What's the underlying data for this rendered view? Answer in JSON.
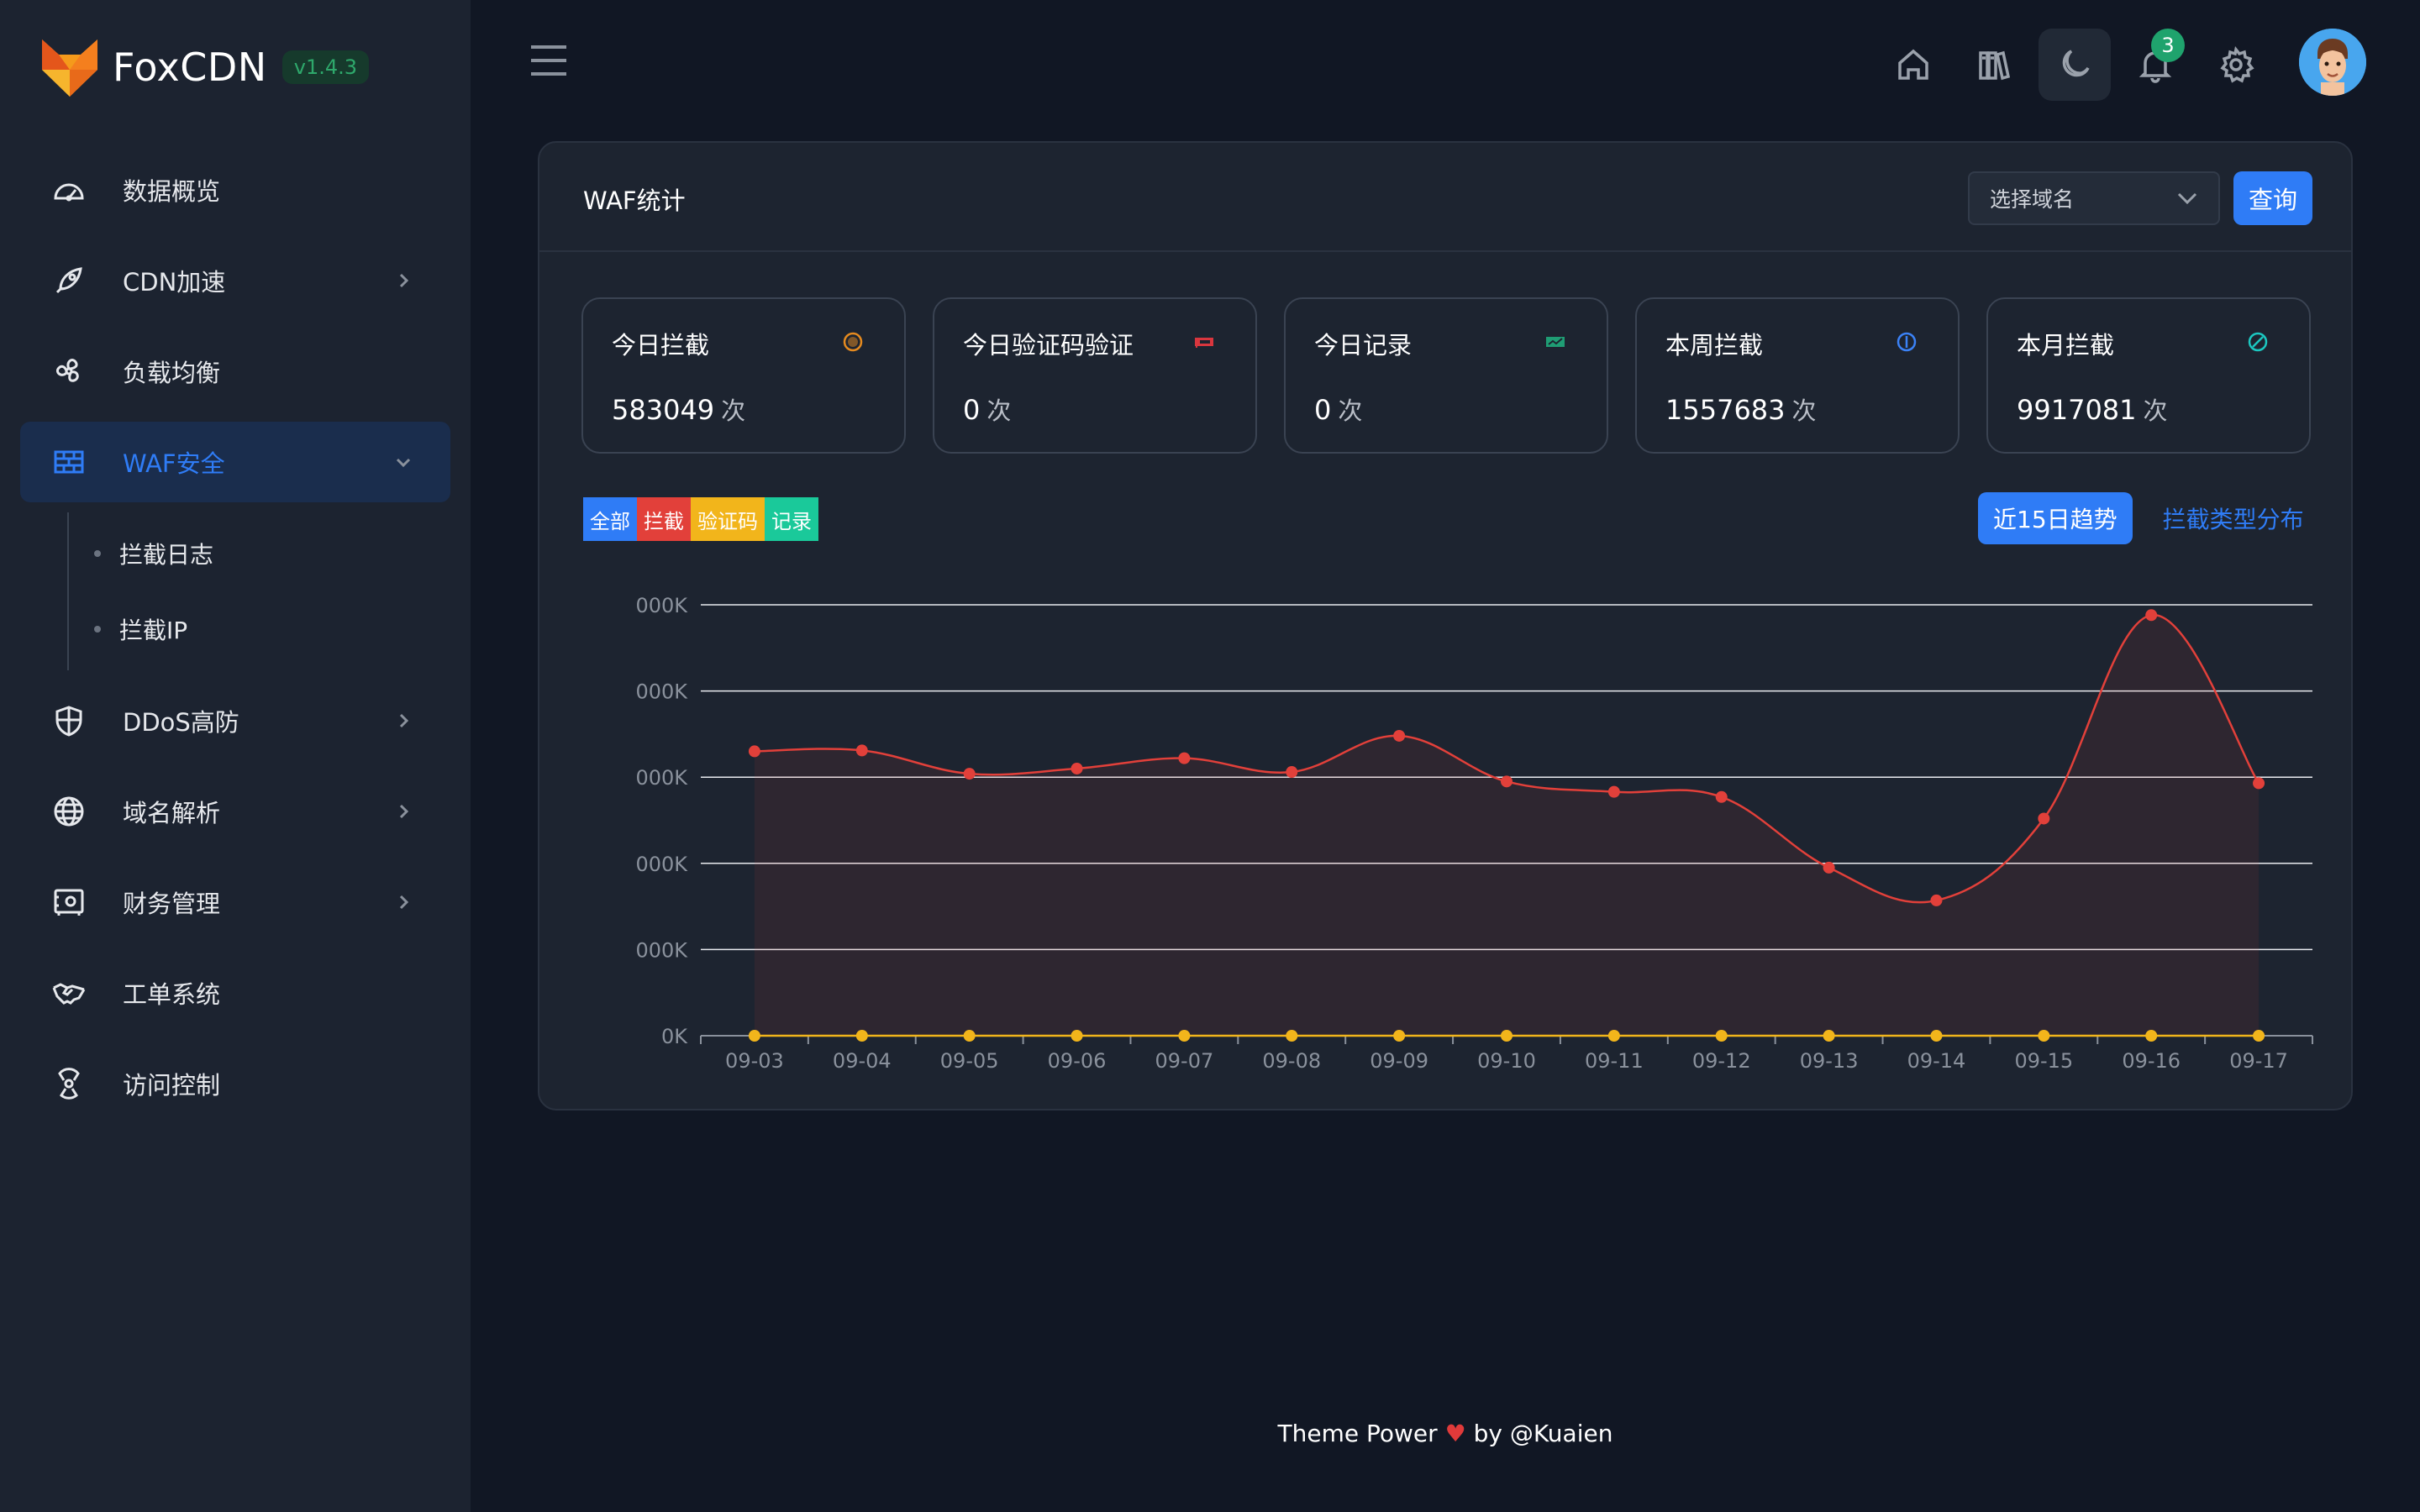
{
  "brand": {
    "name": "FoxCDN",
    "version": "v1.4.3"
  },
  "menu": [
    {
      "label": "数据概览",
      "icon": "dashboard-icon",
      "has_children": false
    },
    {
      "label": "CDN加速",
      "icon": "rocket-icon",
      "has_children": true
    },
    {
      "label": "负载均衡",
      "icon": "fan-icon",
      "has_children": false
    },
    {
      "label": "WAF安全",
      "icon": "firewall-icon",
      "has_children": true,
      "active": true,
      "expanded": true,
      "children": [
        {
          "label": "拦截日志"
        },
        {
          "label": "拦截IP"
        }
      ]
    },
    {
      "label": "DDoS高防",
      "icon": "shield-icon",
      "has_children": true
    },
    {
      "label": "域名解析",
      "icon": "globe-icon",
      "has_children": true
    },
    {
      "label": "财务管理",
      "icon": "safe-icon",
      "has_children": true
    },
    {
      "label": "工单系统",
      "icon": "handshake-icon",
      "has_children": false
    },
    {
      "label": "访问控制",
      "icon": "access-control-icon",
      "has_children": false
    }
  ],
  "topbar": {
    "notification_count": "3",
    "icons": [
      "home-icon",
      "books-icon",
      "moon-icon",
      "bell-icon",
      "gear-icon"
    ]
  },
  "card": {
    "title": "WAF统计",
    "domain_select_placeholder": "选择域名",
    "query_label": "查询",
    "stats": [
      {
        "title": "今日拦截",
        "value": "583049",
        "unit": "次",
        "icon_color": "#e58a1f"
      },
      {
        "title": "今日验证码验证",
        "value": "0",
        "unit": "次",
        "icon_color": "#d9363e"
      },
      {
        "title": "今日记录",
        "value": "0",
        "unit": "次",
        "icon_color": "#1f9d74"
      },
      {
        "title": "本周拦截",
        "value": "1557683",
        "unit": "次",
        "icon_color": "#3b82f6"
      },
      {
        "title": "本月拦截",
        "value": "9917081",
        "unit": "次",
        "icon_color": "#1cc7c0"
      }
    ],
    "legend": [
      {
        "label": "全部",
        "color": "#2f7cf6"
      },
      {
        "label": "拦截",
        "color": "#e2403a"
      },
      {
        "label": "验证码",
        "color": "#f2b51b"
      },
      {
        "label": "记录",
        "color": "#1ac99a"
      }
    ],
    "tabs": {
      "active": "近15日趋势",
      "other": "拦截类型分布"
    }
  },
  "chart_data": {
    "type": "area",
    "categories": [
      "09-03",
      "09-04",
      "09-05",
      "09-06",
      "09-07",
      "09-08",
      "09-09",
      "09-10",
      "09-11",
      "09-12",
      "09-13",
      "09-14",
      "09-15",
      "09-16",
      "09-17"
    ],
    "y_tick_labels": [
      "0K",
      "000K",
      "000K",
      "000K",
      "000K",
      "000K"
    ],
    "ylim": [
      0,
      5
    ],
    "series": [
      {
        "color": "#e2403a",
        "values": [
          3.3,
          3.31,
          3.04,
          3.1,
          3.22,
          3.06,
          3.48,
          2.95,
          2.83,
          2.77,
          1.95,
          1.57,
          2.52,
          4.88,
          2.93
        ]
      },
      {
        "color": "#f2b51b",
        "values": [
          0,
          0,
          0,
          0,
          0,
          0,
          0,
          0,
          0,
          0,
          0,
          0,
          0,
          0,
          0
        ]
      }
    ],
    "grid": true
  },
  "footer": {
    "text_before": "Theme Power",
    "text_after": "by @Kuaien"
  }
}
